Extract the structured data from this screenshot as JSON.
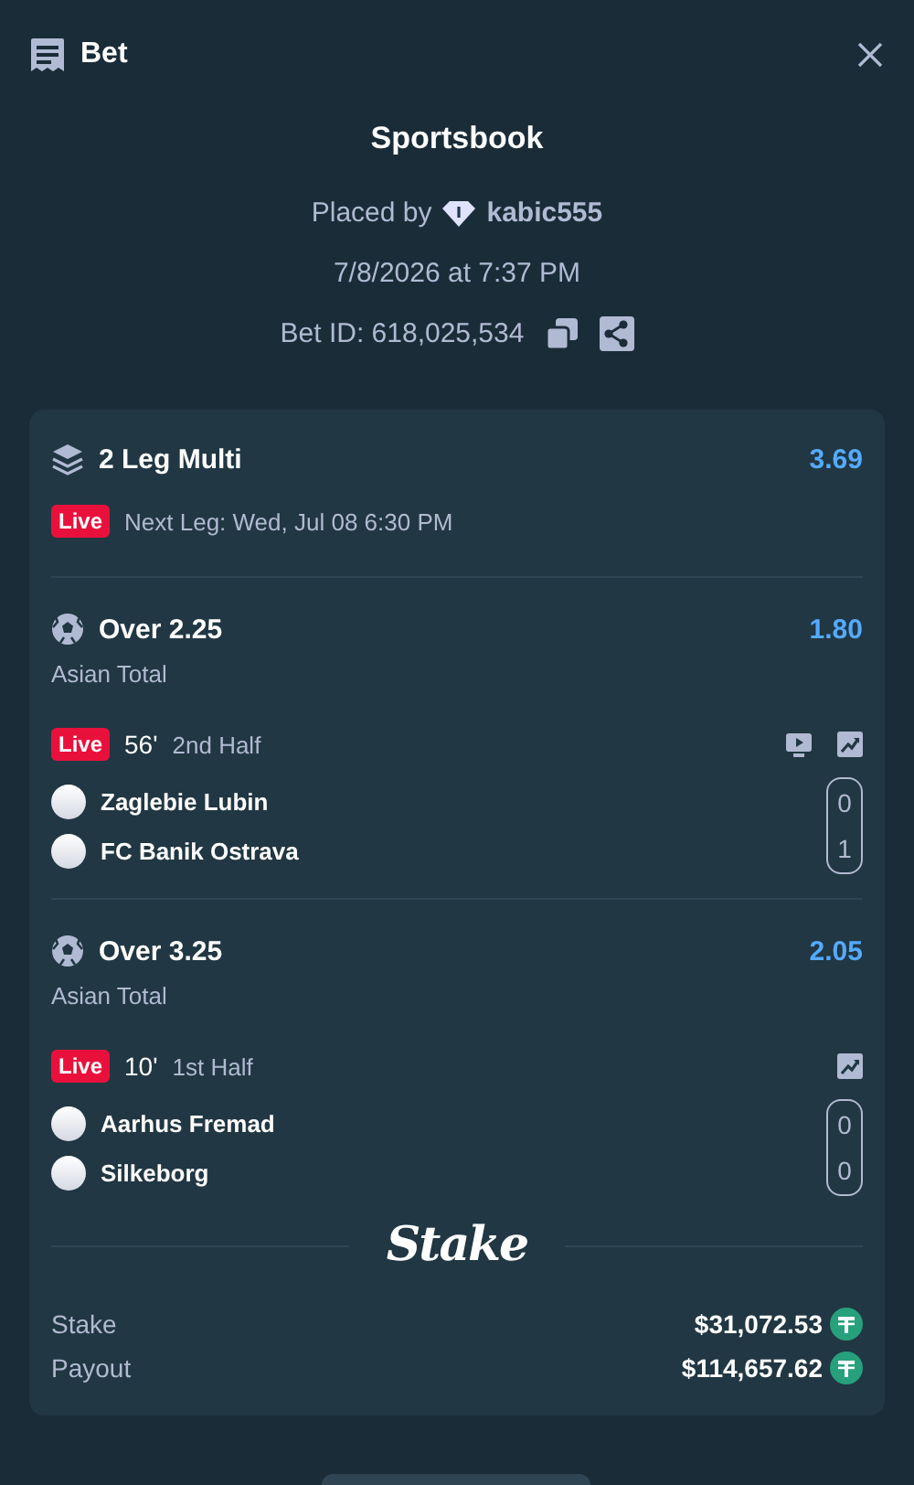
{
  "header": {
    "title": "Bet"
  },
  "summary": {
    "title": "Sportsbook",
    "placed_by": "Placed by",
    "username": "kabic555",
    "date": "7/8/2026 at 7:37 PM",
    "bet_id": "Bet ID: 618,025,534"
  },
  "multi": {
    "title": "2 Leg Multi",
    "odds": "3.69",
    "live_badge": "Live",
    "next_leg": "Next Leg: Wed, Jul 08 6:30 PM"
  },
  "legs": [
    {
      "selection": "Over 2.25",
      "odds": "1.80",
      "market": "Asian Total",
      "live_badge": "Live",
      "minute": "56'",
      "period": "2nd Half",
      "actions": [
        {
          "kind": "stream"
        },
        {
          "kind": "stats"
        }
      ],
      "teams": [
        {
          "name": "Zaglebie Lubin",
          "score": "0"
        },
        {
          "name": "FC Banik Ostrava",
          "score": "1"
        }
      ]
    },
    {
      "selection": "Over 3.25",
      "odds": "2.05",
      "market": "Asian Total",
      "live_badge": "Live",
      "minute": "10'",
      "period": "1st Half",
      "actions": [
        {
          "kind": "stats"
        }
      ],
      "teams": [
        {
          "name": "Aarhus Fremad",
          "score": "0"
        },
        {
          "name": "Silkeborg",
          "score": "0"
        }
      ]
    }
  ],
  "brand": "Stake",
  "totals": [
    {
      "label": "Stake",
      "amount": "$31,072.53"
    },
    {
      "label": "Payout",
      "amount": "$114,657.62"
    }
  ]
}
